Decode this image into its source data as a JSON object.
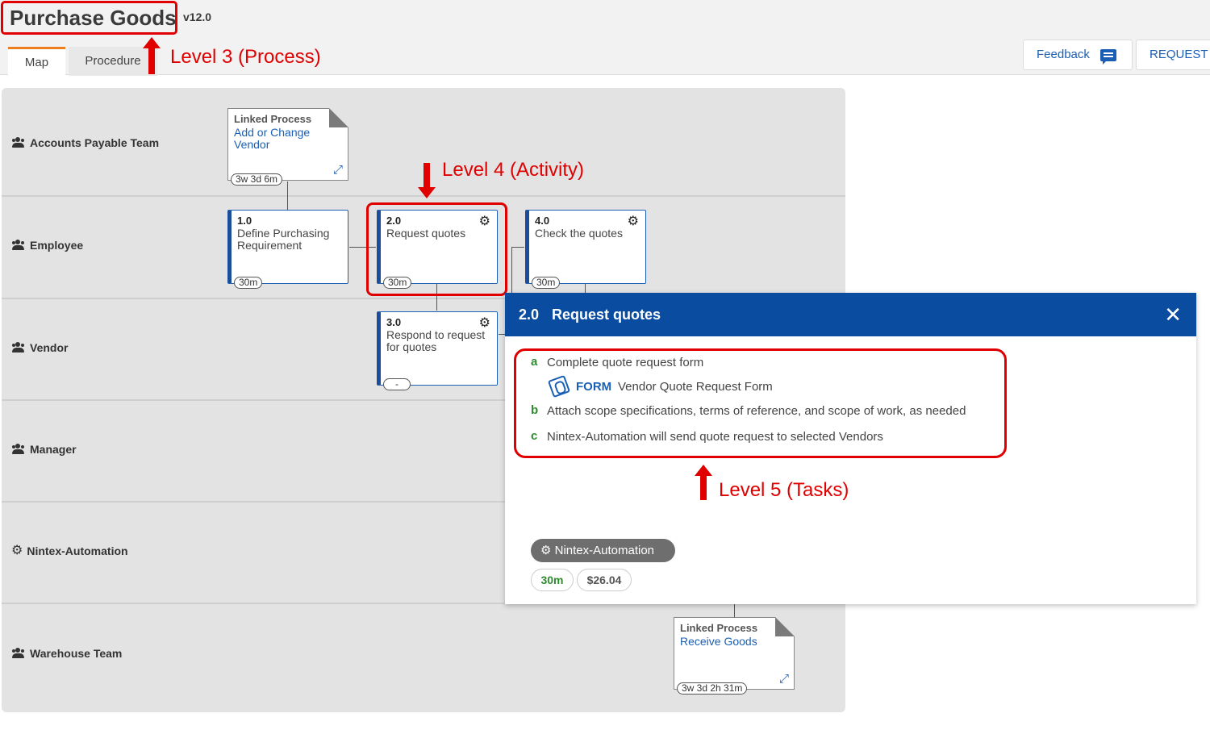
{
  "header": {
    "title": "Purchase Goods",
    "version": "v12.0",
    "tabs": [
      {
        "label": "Map",
        "active": true
      },
      {
        "label": "Procedure",
        "active": false
      }
    ],
    "buttons": {
      "feedback": "Feedback",
      "request": "REQUEST A"
    }
  },
  "annotations": {
    "level3": "Level 3 (Process)",
    "level4": "Level 4 (Activity)",
    "level5": "Level 5 (Tasks)"
  },
  "lanes": [
    {
      "label": "Accounts Payable Team",
      "icon": "people-icon"
    },
    {
      "label": "Employee",
      "icon": "people-icon"
    },
    {
      "label": "Vendor",
      "icon": "people-icon"
    },
    {
      "label": "Manager",
      "icon": "people-icon"
    },
    {
      "label": "Nintex-Automation",
      "icon": "gear-icon"
    },
    {
      "label": "Warehouse Team",
      "icon": "people-icon"
    }
  ],
  "linked_processes": [
    {
      "heading": "Linked Process",
      "name": "Add or Change Vendor",
      "duration": "3w 3d 6m"
    },
    {
      "heading": "Linked Process",
      "name": "Receive Goods",
      "duration": "3w 3d 2h 31m"
    }
  ],
  "activities": [
    {
      "number": "1.0",
      "name": "Define Purchasing Requirement",
      "duration": "30m",
      "automated": false
    },
    {
      "number": "2.0",
      "name": "Request quotes",
      "duration": "30m",
      "automated": true
    },
    {
      "number": "3.0",
      "name": "Respond to request for quotes",
      "duration": "-",
      "automated": true
    },
    {
      "number": "4.0",
      "name": "Check the quotes",
      "duration": "30m",
      "automated": true
    }
  ],
  "popup": {
    "number": "2.0",
    "title": "Request quotes",
    "close": "✕",
    "tasks": [
      {
        "letter": "a",
        "text": "Complete quote request form"
      },
      {
        "letter": "b",
        "text": "Attach scope specifications, terms of reference, and scope of work, as needed"
      },
      {
        "letter": "c",
        "text": "Nintex-Automation will send quote request to selected Vendors"
      }
    ],
    "form": {
      "kind": "FORM",
      "name": "Vendor Quote Request Form"
    },
    "system": "Nintex-Automation",
    "time": "30m",
    "cost": "$26.04"
  },
  "colors": {
    "accent_red": "#e00000",
    "brand_blue": "#0a4da0",
    "tab_orange": "#ef7d22",
    "task_green": "#2e8b2e"
  }
}
